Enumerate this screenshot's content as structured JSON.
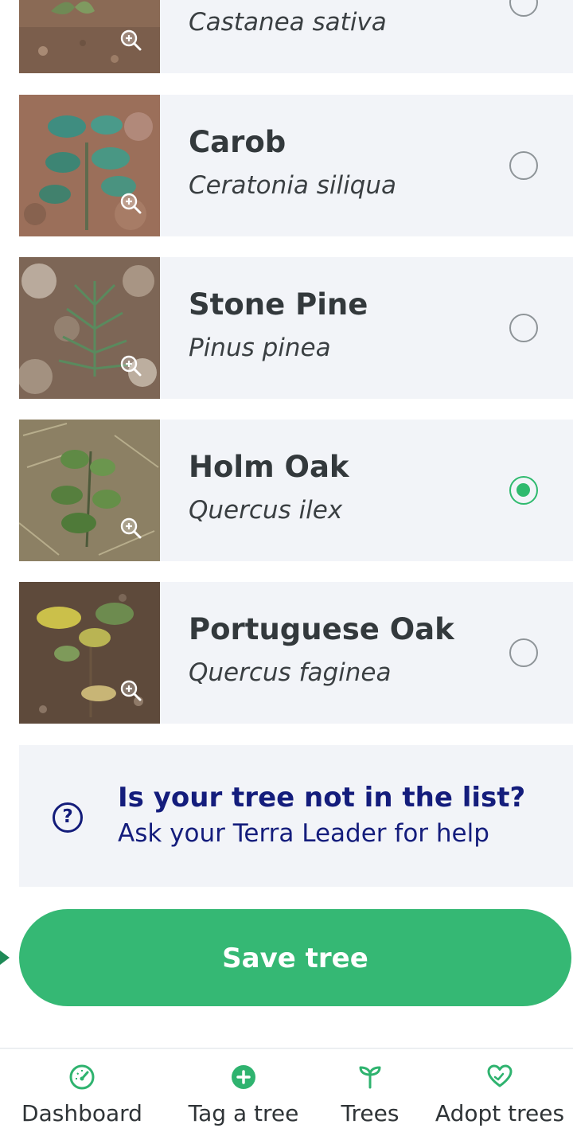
{
  "species": [
    {
      "common": "",
      "scientific": "Castanea sativa",
      "selected": false
    },
    {
      "common": "Carob",
      "scientific": "Ceratonia siliqua",
      "selected": false
    },
    {
      "common": "Stone Pine",
      "scientific": "Pinus pinea",
      "selected": false
    },
    {
      "common": "Holm Oak",
      "scientific": "Quercus ilex",
      "selected": true
    },
    {
      "common": "Portuguese Oak",
      "scientific": "Quercus faginea",
      "selected": false
    }
  ],
  "help": {
    "icon": "question-circle-icon",
    "title": "Is your tree not in the list?",
    "subtitle": "Ask your Terra Leader for help"
  },
  "save_button": {
    "label": "Save tree"
  },
  "bottom_nav": [
    {
      "label": "Dashboard",
      "icon": "gauge-icon"
    },
    {
      "label": "Tag a tree",
      "icon": "plus-circle-icon"
    },
    {
      "label": "Trees",
      "icon": "sprout-icon"
    },
    {
      "label": "Adopt trees",
      "icon": "heart-hands-icon"
    }
  ],
  "colors": {
    "accent_green": "#35b874",
    "radio_selected": "#2fba6e",
    "help_text_navy": "#141d7c",
    "card_background": "#f2f4f8"
  }
}
